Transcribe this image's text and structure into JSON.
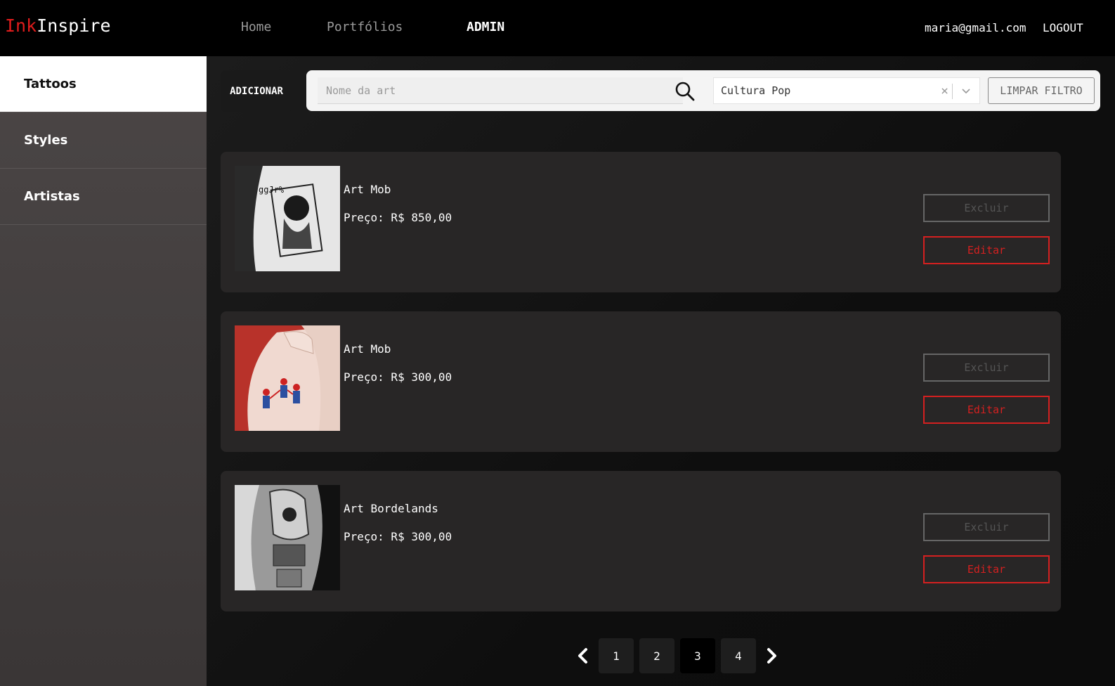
{
  "brand": {
    "part1": "Ink",
    "part2": "Inspire"
  },
  "nav": {
    "items": [
      {
        "label": "Home"
      },
      {
        "label": "Portfólios"
      },
      {
        "label": "ADMIN"
      }
    ]
  },
  "user": {
    "email": "maria@gmail.com",
    "logout": "LOGOUT"
  },
  "sidebar": {
    "items": [
      {
        "label": "Tattoos"
      },
      {
        "label": "Styles"
      },
      {
        "label": "Artistas"
      }
    ]
  },
  "toolbar": {
    "add_label": "ADICIONAR",
    "search_placeholder": "Nome da art",
    "search_value": "",
    "category_value": "Cultura Pop",
    "clear_filter_label": "LIMPAR FILTRO"
  },
  "cards": [
    {
      "title": "Art Mob",
      "price": "Preço: R$ 850,00",
      "delete_label": "Excluir",
      "edit_label": "Editar"
    },
    {
      "title": "Art Mob",
      "price": "Preço: R$ 300,00",
      "delete_label": "Excluir",
      "edit_label": "Editar"
    },
    {
      "title": "Art Bordelands",
      "price": "Preço: R$ 300,00",
      "delete_label": "Excluir",
      "edit_label": "Editar"
    }
  ],
  "pagination": {
    "pages": [
      "1",
      "2",
      "3",
      "4"
    ],
    "current": "3"
  },
  "colors": {
    "accent_red": "#d42020",
    "logo_red": "#e01c1c",
    "topbar": "#000000",
    "sidebar": "#4b4646",
    "card": "#282626"
  }
}
